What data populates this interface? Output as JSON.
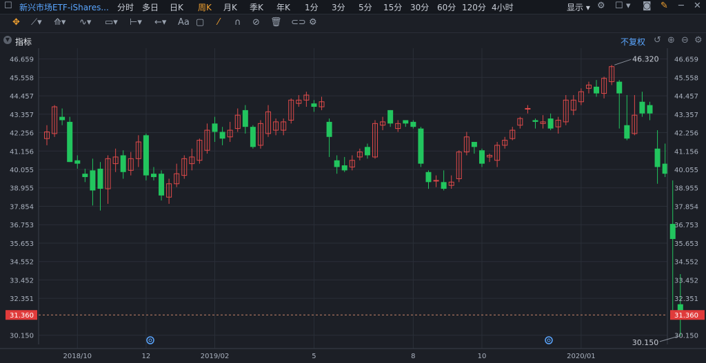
{
  "header": {
    "title": "新兴市场ETF-iShares...",
    "periods": [
      "分时",
      "多日",
      "日K",
      "周K",
      "月K",
      "季K",
      "年K",
      "1分",
      "3分",
      "5分",
      "15分",
      "30分",
      "60分",
      "120分",
      "4小时"
    ],
    "active_period": "周K",
    "display_label": "显示"
  },
  "indicator_bar": {
    "label": "指标",
    "fq_label": "不复权"
  },
  "colors": {
    "up": "#e04a4a",
    "down": "#22c55e",
    "background": "#1c1f26",
    "grid": "#2a2f38",
    "current_price_bg": "#e03b3b"
  },
  "chart_data": {
    "type": "candlestick",
    "y_ticks": [
      46.659,
      45.558,
      44.457,
      43.357,
      42.256,
      41.156,
      40.055,
      38.955,
      37.854,
      36.753,
      35.653,
      34.552,
      33.452,
      32.351,
      30.15
    ],
    "x_ticks": [
      "2018/10",
      "12",
      "2019/02",
      "5",
      "8",
      "10",
      "2020/01"
    ],
    "ylim": [
      29.6,
      47.3
    ],
    "high_label": "46.320",
    "low_label": "30.150",
    "current_price": "31.360",
    "candles": [
      [
        41.9,
        42.3,
        41.5,
        42.7
      ],
      [
        42.2,
        43.8,
        42.0,
        43.9
      ],
      [
        43.2,
        43.0,
        42.7,
        43.7
      ],
      [
        42.9,
        40.5,
        40.5,
        43.2
      ],
      [
        40.6,
        40.4,
        40.1,
        40.9
      ],
      [
        39.8,
        39.6,
        39.3,
        40.1
      ],
      [
        40.0,
        38.8,
        37.9,
        40.7
      ],
      [
        40.1,
        38.9,
        37.6,
        40.5
      ],
      [
        38.9,
        40.7,
        38.0,
        40.9
      ],
      [
        40.4,
        40.8,
        39.9,
        41.3
      ],
      [
        40.9,
        39.9,
        39.5,
        41.2
      ],
      [
        40.0,
        40.7,
        39.7,
        41.1
      ],
      [
        40.7,
        41.7,
        40.2,
        42.1
      ],
      [
        42.1,
        39.7,
        39.4,
        42.2
      ],
      [
        39.8,
        39.6,
        39.4,
        40.2
      ],
      [
        39.8,
        38.5,
        38.2,
        40.0
      ],
      [
        38.4,
        39.2,
        38.0,
        39.5
      ],
      [
        39.2,
        39.8,
        39.0,
        40.4
      ],
      [
        39.7,
        40.7,
        39.5,
        40.9
      ],
      [
        40.4,
        40.8,
        40.0,
        41.3
      ],
      [
        40.6,
        41.8,
        40.4,
        41.9
      ],
      [
        41.2,
        42.4,
        41.0,
        42.8
      ],
      [
        42.8,
        42.3,
        41.7,
        43.2
      ],
      [
        42.3,
        41.9,
        41.5,
        42.6
      ],
      [
        42.0,
        42.4,
        41.7,
        42.9
      ],
      [
        42.5,
        43.3,
        42.3,
        43.7
      ],
      [
        43.6,
        42.6,
        42.2,
        43.9
      ],
      [
        42.6,
        41.4,
        41.3,
        42.7
      ],
      [
        41.5,
        42.8,
        41.3,
        43.0
      ],
      [
        42.2,
        43.5,
        42.0,
        43.9
      ],
      [
        42.4,
        42.9,
        42.1,
        43.1
      ],
      [
        42.4,
        42.9,
        42.1,
        43.1
      ],
      [
        43.0,
        44.2,
        42.8,
        44.3
      ],
      [
        44.0,
        44.2,
        43.8,
        44.5
      ],
      [
        44.2,
        44.5,
        43.8,
        44.7
      ],
      [
        44.0,
        43.8,
        43.5,
        44.2
      ],
      [
        43.8,
        44.1,
        43.6,
        44.4
      ],
      [
        42.9,
        42.0,
        40.8,
        43.1
      ],
      [
        40.6,
        40.2,
        39.8,
        40.9
      ],
      [
        40.3,
        40.0,
        39.9,
        40.8
      ],
      [
        40.2,
        40.6,
        40.0,
        40.9
      ],
      [
        40.8,
        41.1,
        40.6,
        41.3
      ],
      [
        41.4,
        40.9,
        40.7,
        41.6
      ],
      [
        40.8,
        42.8,
        40.7,
        43.0
      ],
      [
        42.7,
        42.9,
        42.4,
        43.2
      ],
      [
        43.6,
        42.8,
        42.6,
        43.6
      ],
      [
        42.5,
        42.8,
        42.3,
        43.0
      ],
      [
        43.0,
        42.8,
        42.6,
        43.0
      ],
      [
        42.9,
        42.6,
        42.5,
        43.0
      ],
      [
        42.5,
        40.4,
        40.2,
        42.6
      ],
      [
        39.9,
        39.3,
        38.9,
        40.0
      ],
      [
        39.4,
        39.4,
        39.0,
        39.7
      ],
      [
        39.3,
        38.9,
        38.8,
        40.0
      ],
      [
        39.1,
        39.3,
        38.9,
        39.7
      ],
      [
        39.5,
        41.1,
        39.3,
        41.2
      ],
      [
        41.1,
        42.0,
        40.9,
        42.3
      ],
      [
        41.7,
        41.4,
        41.0,
        41.7
      ],
      [
        41.2,
        40.4,
        40.2,
        41.3
      ],
      [
        40.8,
        40.9,
        40.5,
        41.0
      ],
      [
        40.6,
        41.5,
        40.2,
        41.7
      ],
      [
        41.5,
        41.8,
        41.3,
        42.0
      ],
      [
        41.9,
        42.4,
        41.8,
        42.6
      ],
      [
        42.7,
        43.1,
        42.5,
        43.2
      ],
      [
        43.7,
        43.7,
        43.4,
        43.9
      ],
      [
        43.0,
        42.9,
        42.5,
        43.1
      ],
      [
        42.8,
        42.9,
        42.5,
        43.3
      ],
      [
        43.1,
        42.5,
        42.4,
        43.4
      ],
      [
        42.6,
        43.0,
        42.2,
        43.2
      ],
      [
        42.9,
        44.2,
        42.7,
        44.5
      ],
      [
        43.6,
        44.2,
        43.3,
        44.5
      ],
      [
        44.1,
        44.7,
        43.9,
        44.9
      ],
      [
        44.9,
        45.1,
        44.6,
        45.3
      ],
      [
        45.0,
        44.6,
        44.4,
        45.4
      ],
      [
        44.6,
        45.5,
        44.3,
        45.6
      ],
      [
        45.3,
        46.2,
        45.1,
        46.3
      ],
      [
        45.3,
        44.6,
        42.5,
        45.4
      ],
      [
        42.7,
        41.9,
        41.8,
        44.5
      ],
      [
        42.2,
        43.3,
        42.1,
        44.5
      ],
      [
        44.1,
        43.4,
        43.2,
        44.7
      ],
      [
        43.9,
        43.4,
        43.0,
        44.1
      ],
      [
        41.3,
        40.2,
        39.2,
        42.4
      ],
      [
        40.4,
        39.8,
        39.6,
        41.6
      ],
      [
        36.8,
        35.9,
        31.2,
        39.4
      ],
      [
        32.0,
        31.3,
        30.1,
        33.8
      ]
    ]
  }
}
